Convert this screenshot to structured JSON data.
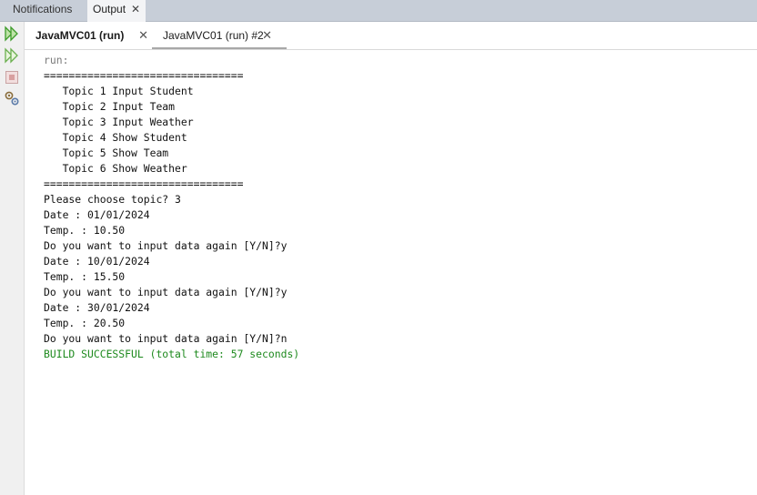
{
  "panel_tabs": [
    {
      "label": "Notifications"
    },
    {
      "label": "Output",
      "close": "✕"
    }
  ],
  "output_tabs": [
    {
      "label": "JavaMVC01 (run)",
      "close": "✕"
    },
    {
      "label": "JavaMVC01 (run) #2",
      "close": "✕"
    }
  ],
  "toolbar": {
    "icons": [
      "rerun-icon",
      "rerun-with-params-icon",
      "stop-icon",
      "settings-icon"
    ]
  },
  "colors": {
    "tab_bar": "#c7ced8",
    "rerun_green": "#3f9c2b",
    "stop_red": "#d8a0a0",
    "success_green": "#1e8a1e"
  },
  "console": {
    "lines": [
      {
        "text": "run:",
        "style": "dim"
      },
      {
        "text": "================================",
        "style": "normal"
      },
      {
        "text": "   Topic 1 Input Student",
        "style": "normal"
      },
      {
        "text": "   Topic 2 Input Team",
        "style": "normal"
      },
      {
        "text": "   Topic 3 Input Weather",
        "style": "normal"
      },
      {
        "text": "   Topic 4 Show Student",
        "style": "normal"
      },
      {
        "text": "   Topic 5 Show Team",
        "style": "normal"
      },
      {
        "text": "   Topic 6 Show Weather",
        "style": "normal"
      },
      {
        "text": "================================",
        "style": "normal"
      },
      {
        "text": "Please choose topic? 3",
        "style": "normal"
      },
      {
        "text": "Date : 01/01/2024",
        "style": "normal"
      },
      {
        "text": "Temp. : 10.50",
        "style": "normal"
      },
      {
        "text": "Do you want to input data again [Y/N]?y",
        "style": "normal"
      },
      {
        "text": "Date : 10/01/2024",
        "style": "normal"
      },
      {
        "text": "Temp. : 15.50",
        "style": "normal"
      },
      {
        "text": "Do you want to input data again [Y/N]?y",
        "style": "normal"
      },
      {
        "text": "Date : 30/01/2024",
        "style": "normal"
      },
      {
        "text": "Temp. : 20.50",
        "style": "normal"
      },
      {
        "text": "Do you want to input data again [Y/N]?n",
        "style": "normal"
      },
      {
        "text": "BUILD SUCCESSFUL (total time: 57 seconds)",
        "style": "success"
      }
    ]
  }
}
